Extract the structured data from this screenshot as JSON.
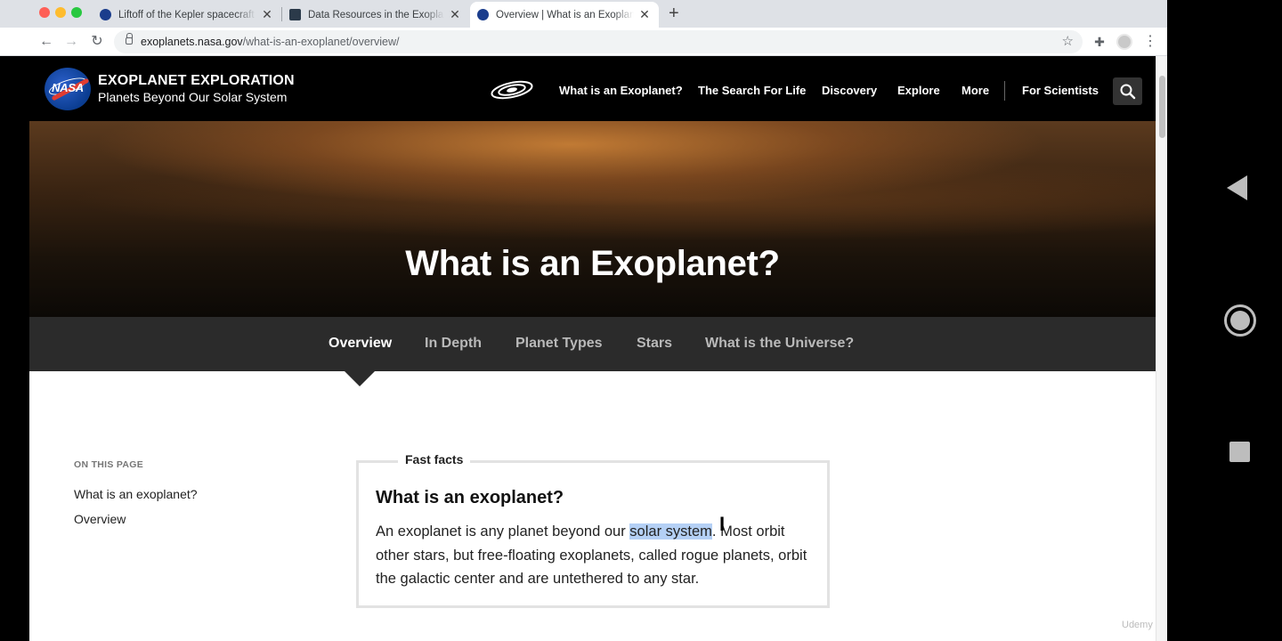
{
  "browser": {
    "tabs": [
      {
        "title": "Liftoff of the Kepler spacecraft",
        "favicon": "nasa-icon"
      },
      {
        "title": "Data Resources in the Exoplanet",
        "favicon": "archive-icon"
      },
      {
        "title": "Overview | What is an Exoplanet",
        "favicon": "nasa-icon",
        "active": true
      }
    ],
    "url_domain": "exoplanets.nasa.gov",
    "url_path": "/what-is-an-exoplanet/overview/"
  },
  "site": {
    "brand_title": "EXOPLANET EXPLORATION",
    "brand_subtitle": "Planets Beyond Our Solar System",
    "logo_text": "NASA",
    "nav": [
      "What is an Exoplanet?",
      "The Search For Life",
      "Discovery",
      "Explore",
      "More",
      "For Scientists"
    ]
  },
  "hero": {
    "title": "What is an Exoplanet?"
  },
  "subnav": {
    "items": [
      "Overview",
      "In Depth",
      "Planet Types",
      "Stars",
      "What is the Universe?"
    ],
    "active": "Overview"
  },
  "on_this_page": {
    "heading": "ON THIS PAGE",
    "links": [
      "What is an exoplanet?",
      "Overview"
    ]
  },
  "fast_facts": {
    "label": "Fast facts",
    "question": "What is an exoplanet?",
    "body_before": "An exoplanet is any planet beyond our ",
    "body_highlight": "solar system",
    "body_after": ". Most orbit other stars, but free-floating exoplanets, called rogue planets, orbit the galactic center and are untethered to any star."
  },
  "watermark": "Udemy",
  "colors": {
    "highlight": "#b4d0f5",
    "header_bg": "#000000",
    "subnav_bg": "#2b2b2b"
  }
}
